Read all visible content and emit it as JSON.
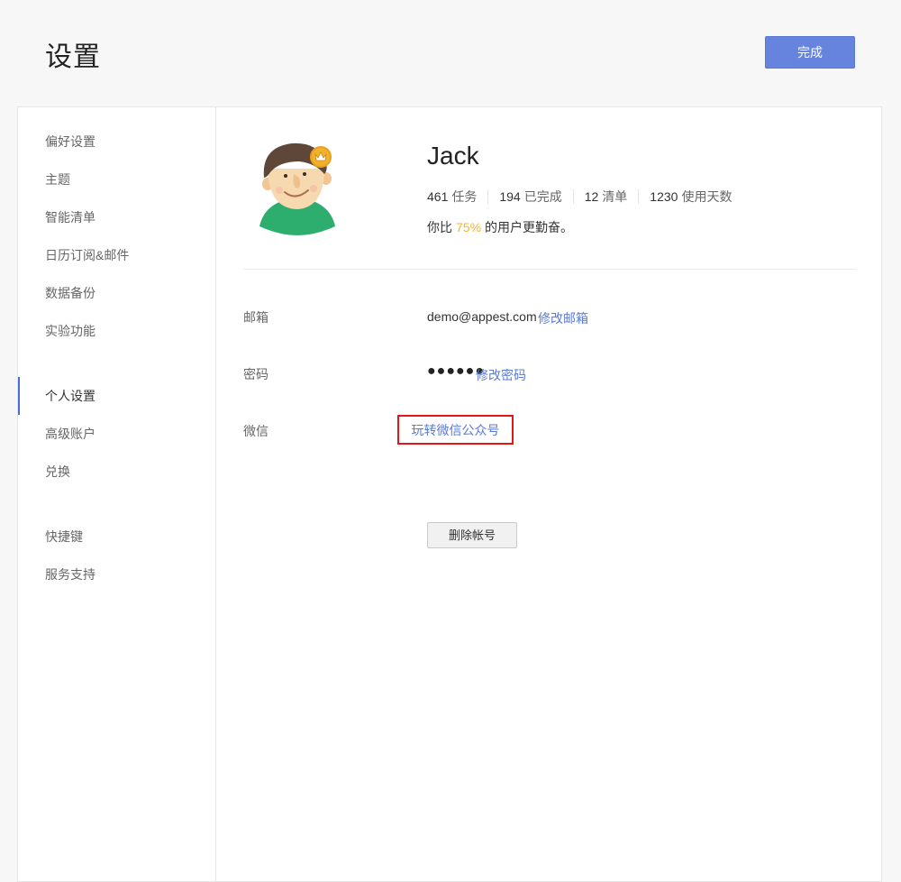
{
  "header": {
    "title": "设置",
    "done_label": "完成"
  },
  "sidebar": {
    "items": [
      {
        "label": "偏好设置"
      },
      {
        "label": "主题"
      },
      {
        "label": "智能清单"
      },
      {
        "label": "日历订阅&邮件"
      },
      {
        "label": "数据备份"
      },
      {
        "label": "实验功能"
      },
      {
        "label": "个人设置",
        "active": true
      },
      {
        "label": "高级账户"
      },
      {
        "label": "兑换"
      },
      {
        "label": "快捷键"
      },
      {
        "label": "服务支持"
      }
    ]
  },
  "profile": {
    "name": "Jack",
    "stats": [
      {
        "value": "461",
        "label": "任务"
      },
      {
        "value": "194",
        "label": "已完成"
      },
      {
        "value": "12",
        "label": "清单"
      },
      {
        "value": "1230",
        "label": "使用天数"
      }
    ],
    "compare_prefix": "你比",
    "compare_pct": "75%",
    "compare_suffix": "的用户更勤奋。"
  },
  "account": {
    "email_label": "邮箱",
    "email_value": "demo@appest.com",
    "email_link": "修改邮箱",
    "password_label": "密码",
    "password_value": "●●●●●●",
    "password_link": "修改密码",
    "wechat_label": "微信",
    "wechat_link": "玩转微信公众号",
    "delete_label": "删除帐号"
  },
  "colors": {
    "accent": "#6683dd",
    "link": "#5a7ad6",
    "highlight": "#f3b32f",
    "callout": "#e01818",
    "avatar_shirt": "#2eae6e"
  }
}
